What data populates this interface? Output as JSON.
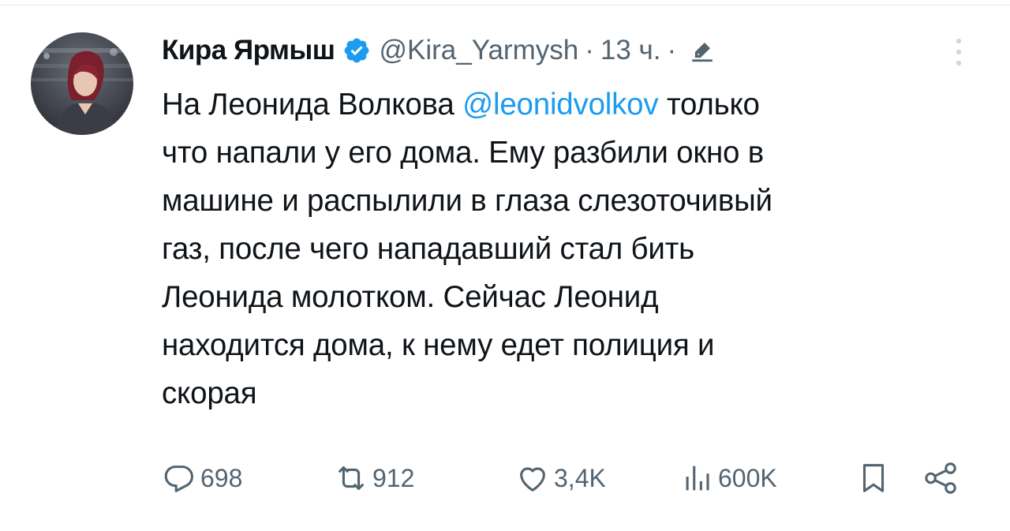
{
  "author": {
    "display_name": "Кира Ярмыш",
    "handle": "@Kira_Yarmysh",
    "separator": "·",
    "timestamp": "13 ч.",
    "verified": true,
    "avatar_icon": "user-avatar-photo",
    "edited_icon": "pencil-edited-icon"
  },
  "tweet": {
    "lines": [
      {
        "pre": "На Леонида Волкова ",
        "mention": "@leonidvolkov",
        "post": " только"
      },
      {
        "text": "что напали у его дома. Ему разбили окно в"
      },
      {
        "text": "машине и распылили в глаза слезоточивый"
      },
      {
        "text": "газ, после чего нападавший стал бить"
      },
      {
        "text": "Леонида молотком. Сейчас Леонид"
      },
      {
        "text": "находится дома, к нему едет полиция и"
      },
      {
        "text": "скорая"
      }
    ]
  },
  "actions": {
    "reply": {
      "icon": "reply-icon",
      "count": "698"
    },
    "retweet": {
      "icon": "retweet-icon",
      "count": "912"
    },
    "like": {
      "icon": "heart-icon",
      "count": "3,4K"
    },
    "views": {
      "icon": "views-chart-icon",
      "count": "600K"
    },
    "bookmark": {
      "icon": "bookmark-icon"
    },
    "share": {
      "icon": "share-icon"
    }
  },
  "colors": {
    "text": "#0f1419",
    "secondary": "#536471",
    "accent": "#1d9bf0"
  }
}
